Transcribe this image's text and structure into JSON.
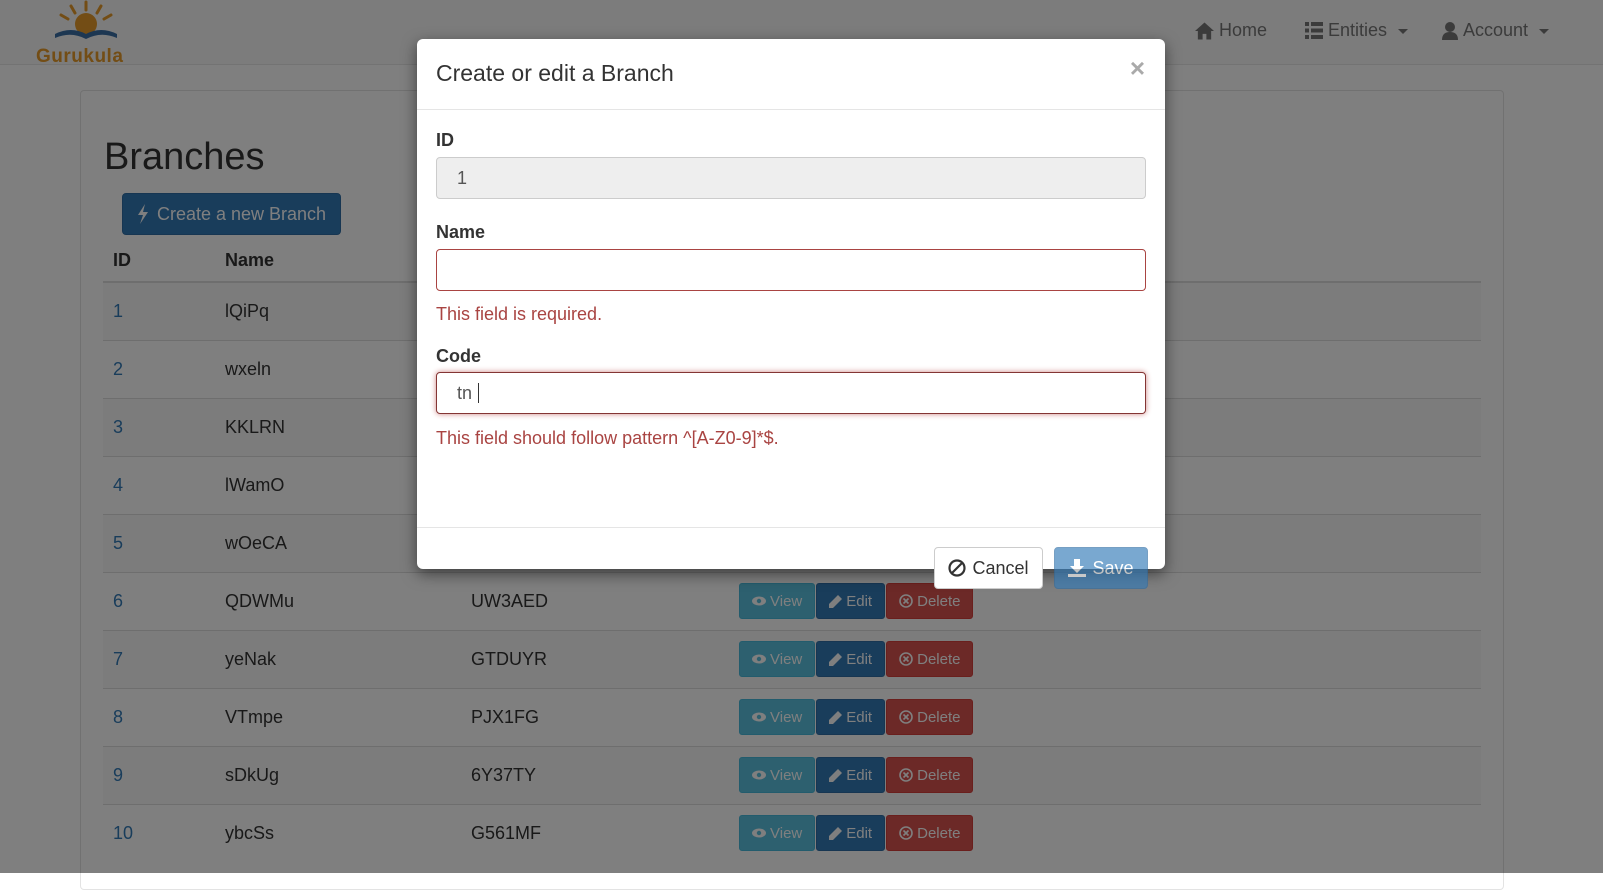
{
  "app": {
    "brand_name": "Gurukula",
    "logo_icon": "gurukula-logo",
    "nav": [
      {
        "label": "Home",
        "icon": "home-icon"
      },
      {
        "label": "Entities",
        "icon": "list-icon"
      },
      {
        "label": "Account",
        "icon": "user-icon"
      }
    ]
  },
  "page": {
    "title": "Branches",
    "create_button_label": "Create a new Branch",
    "table": {
      "headers": [
        "ID",
        "Name"
      ],
      "rows": [
        {
          "id": "1",
          "name": "lQiPq",
          "code": ""
        },
        {
          "id": "2",
          "name": "wxeln",
          "code": ""
        },
        {
          "id": "3",
          "name": "KKLRN",
          "code": ""
        },
        {
          "id": "4",
          "name": "lWamO",
          "code": ""
        },
        {
          "id": "5",
          "name": "wOeCA",
          "code": ""
        },
        {
          "id": "6",
          "name": "QDWMu",
          "code": "UW3AED"
        },
        {
          "id": "7",
          "name": "yeNak",
          "code": "GTDUYR"
        },
        {
          "id": "8",
          "name": "VTmpe",
          "code": "PJX1FG"
        },
        {
          "id": "9",
          "name": "sDkUg",
          "code": "6Y37TY"
        },
        {
          "id": "10",
          "name": "ybcSs",
          "code": "G561MF"
        }
      ],
      "actions": {
        "view": "View",
        "edit": "Edit",
        "delete": "Delete"
      }
    }
  },
  "modal": {
    "title": "Create or edit a Branch",
    "close_glyph": "×",
    "fields": {
      "id": {
        "label": "ID",
        "value": "1"
      },
      "name": {
        "label": "Name",
        "value": "",
        "error": "This field is required."
      },
      "code": {
        "label": "Code",
        "value": "tn",
        "error": "This field should follow pattern ^[A-Z0-9]*$."
      }
    },
    "cancel_label": "Cancel",
    "save_label": "Save"
  },
  "colors": {
    "primary": "#337ab7",
    "info": "#5bc0de",
    "danger": "#d9534f",
    "error_text": "#a94442",
    "brand": "#e69b2a"
  }
}
